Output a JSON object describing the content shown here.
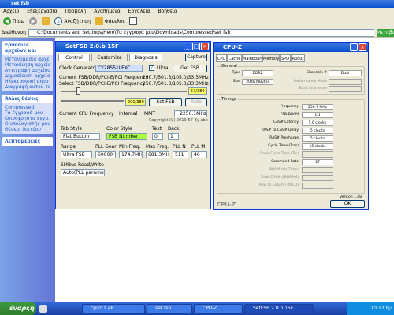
{
  "explorer": {
    "title": "set fsb",
    "menu": [
      "Αρχείο",
      "Επεξεργασία",
      "Προβολή",
      "Αγαπημένα",
      "Εργαλεία",
      "Βοήθεια"
    ],
    "toolbar": {
      "back": "Πίσω",
      "search": "Αναζήτηση",
      "folders": "Φάκελοι"
    },
    "address_label": "Διεύθυνση",
    "address_value": "C:\\Documents and Settings\\Hero\\Τα έγγραφά μου\\Downloads\\Compressed\\set fsb",
    "go_label": "Μετάβαση",
    "sidebar": [
      {
        "title": "Εργασίες αρχείων και",
        "items": [
          "Μετονομασία αρχείου",
          "Μετακίνηση αρχείου",
          "Αντιγραφή αρχείου",
          "Δημοσίευση αρχείου στο Web",
          "Ηλεκτρονική αποστολή αρχείου",
          "Διαγραφή αυτού του"
        ]
      },
      {
        "title": "Άλλες θέσεις",
        "items": [
          "Compressed",
          "Τα έγγραφά μου",
          "Κοινόχρηστα έγγρ.",
          "Ο υπολογιστής μου",
          "Θέσεις δικτύου"
        ]
      },
      {
        "title": "Λεπτομέρειες",
        "items": []
      }
    ]
  },
  "setfsb": {
    "title": "SetFSB 2.0.b 15F",
    "tabs": [
      "Control",
      "Customize",
      "Diagnosis"
    ],
    "capture_label": "Capture",
    "clock_gen_label": "Clock Generator",
    "clock_gen_value": "CY28551LFXC",
    "ultra_label": "Ultra",
    "get_fsb_label": "Get FSB",
    "current_freq_label": "Current FSB/DDR/PCI-E/PCI Frequency",
    "current_freq_value": "250.7/501.3/105.0/33.3MHz",
    "select_freq_label": "Select FSB/DDR/PCI-E/PCI Frequency",
    "select_freq_value": "250.7/501.3/105.0/33.3MHz",
    "slider_value": "57/380",
    "slider2_value": "200/380",
    "set_fsb_label": "Set FSB",
    "auto_label": "Auto",
    "cpu_freq_label": "Current CPU Frequency",
    "internal_label": "Internal",
    "mmt_label": "MMT",
    "cpu_freq_value": "2256.1MHz",
    "copyright": "Copyright (C) 2019-57 By abo",
    "tab_style_label": "Tab Style",
    "tab_style_value": "Flat Button",
    "color_style_label": "Color Style",
    "color_style_value": "FSB Number",
    "text_label": "Text",
    "text_value": "0",
    "back_label": "Back",
    "back_value": "1",
    "range_label": "Range",
    "range_value": "Ultra FSB",
    "pll_gear_label": "PLL Gear",
    "pll_gear_value": "60000",
    "min_freq_label": "Min Freq.",
    "min_freq_value": "174.7MHz",
    "max_freq_label": "Max Freq.",
    "max_freq_value": "681.3MHz",
    "pll_n_label": "PLL N",
    "pll_n_value": "511",
    "pll_m_label": "PLL M",
    "pll_m_value": "46",
    "smbus_label": "SMBus Read/Write",
    "smbus_value": "Auto(PLL parameter)"
  },
  "cpuz": {
    "title": "CPU-Z",
    "tabs": [
      "CPU",
      "Cache",
      "Mainboard",
      "Memory",
      "SPD",
      "About"
    ],
    "general_label": "General",
    "type_label": "Type",
    "type_value": "DDR2",
    "size_label": "Size",
    "size_value": "2048 MBytes",
    "channels_label": "Channels #",
    "channels_value": "Dual",
    "perf_mode_label": "Performance Mode",
    "bank_interleave_label": "Bank Interleave",
    "timings_label": "Timings",
    "timings": [
      {
        "label": "Frequency",
        "value": "250.7 MHz",
        "dim": false
      },
      {
        "label": "FSB:DRAM",
        "value": "1:1",
        "dim": false
      },
      {
        "label": "CAS# Latency",
        "value": "5.0 clocks",
        "dim": false
      },
      {
        "label": "RAS# to CAS# Delay",
        "value": "5 clocks",
        "dim": false
      },
      {
        "label": "RAS# Precharge",
        "value": "5 clocks",
        "dim": false
      },
      {
        "label": "Cycle Time (Tras)",
        "value": "15 clocks",
        "dim": false
      },
      {
        "label": "Bank Cycle Time (Trc)",
        "value": "",
        "dim": true
      },
      {
        "label": "Command Rate",
        "value": "2T",
        "dim": false
      },
      {
        "label": "DRAM Idle Timer",
        "value": "",
        "dim": true
      },
      {
        "label": "Total CAS# (tRDRAM)",
        "value": "",
        "dim": true
      },
      {
        "label": "Row To Column (tRCD)",
        "value": "",
        "dim": true
      }
    ],
    "version": "Version 1.48",
    "ok_label": "OK",
    "logo": "CPU-Z"
  },
  "taskbar": {
    "start_label": "έναρξη",
    "tasks": [
      "cpuz 1.48",
      "set fsb",
      "CPU-Z",
      "SetFSB 2.0.b 15F"
    ],
    "clock": "10:12 πμ"
  }
}
